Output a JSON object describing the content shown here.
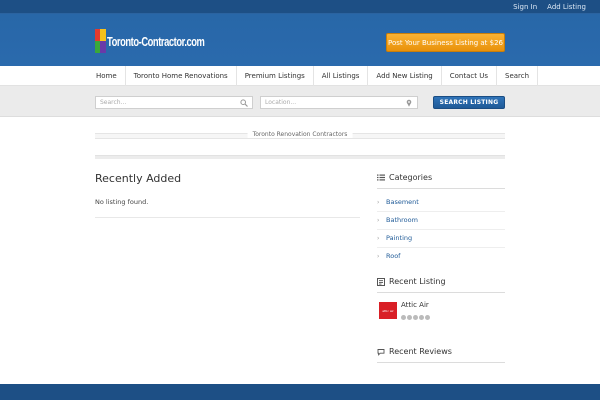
{
  "topbar": {
    "signin": "Sign In",
    "add_listing": "Add Listing"
  },
  "header": {
    "logo_text": "Toronto-Contractor.com",
    "cta_label": "Post Your Business Listing at $26"
  },
  "nav": {
    "items": [
      {
        "label": "Home"
      },
      {
        "label": "Toronto Home Renovations"
      },
      {
        "label": "Premium Listings"
      },
      {
        "label": "All Listings"
      },
      {
        "label": "Add New Listing"
      },
      {
        "label": "Contact Us"
      },
      {
        "label": "Search"
      }
    ]
  },
  "search": {
    "keyword_placeholder": "Search...",
    "location_placeholder": "Location...",
    "button_label": "SEARCH LISTING"
  },
  "breadcrumb": {
    "label": "Toronto Renovation Contractors"
  },
  "main": {
    "title": "Recently Added",
    "empty_text": "No listing found."
  },
  "sidebar": {
    "categories_title": "Categories",
    "categories": [
      {
        "label": "Basement"
      },
      {
        "label": "Bathroom"
      },
      {
        "label": "Painting"
      },
      {
        "label": "Roof"
      }
    ],
    "recent_listing_title": "Recent Listing",
    "recent_listing": {
      "name": "Attic Air",
      "thumb_text": "attic air",
      "rating": 0,
      "rating_max": 5
    },
    "recent_reviews_title": "Recent Reviews"
  },
  "colors": {
    "brand_blue": "#2867a8",
    "cta_orange": "#f0a020",
    "thumb_red": "#d91f26"
  }
}
